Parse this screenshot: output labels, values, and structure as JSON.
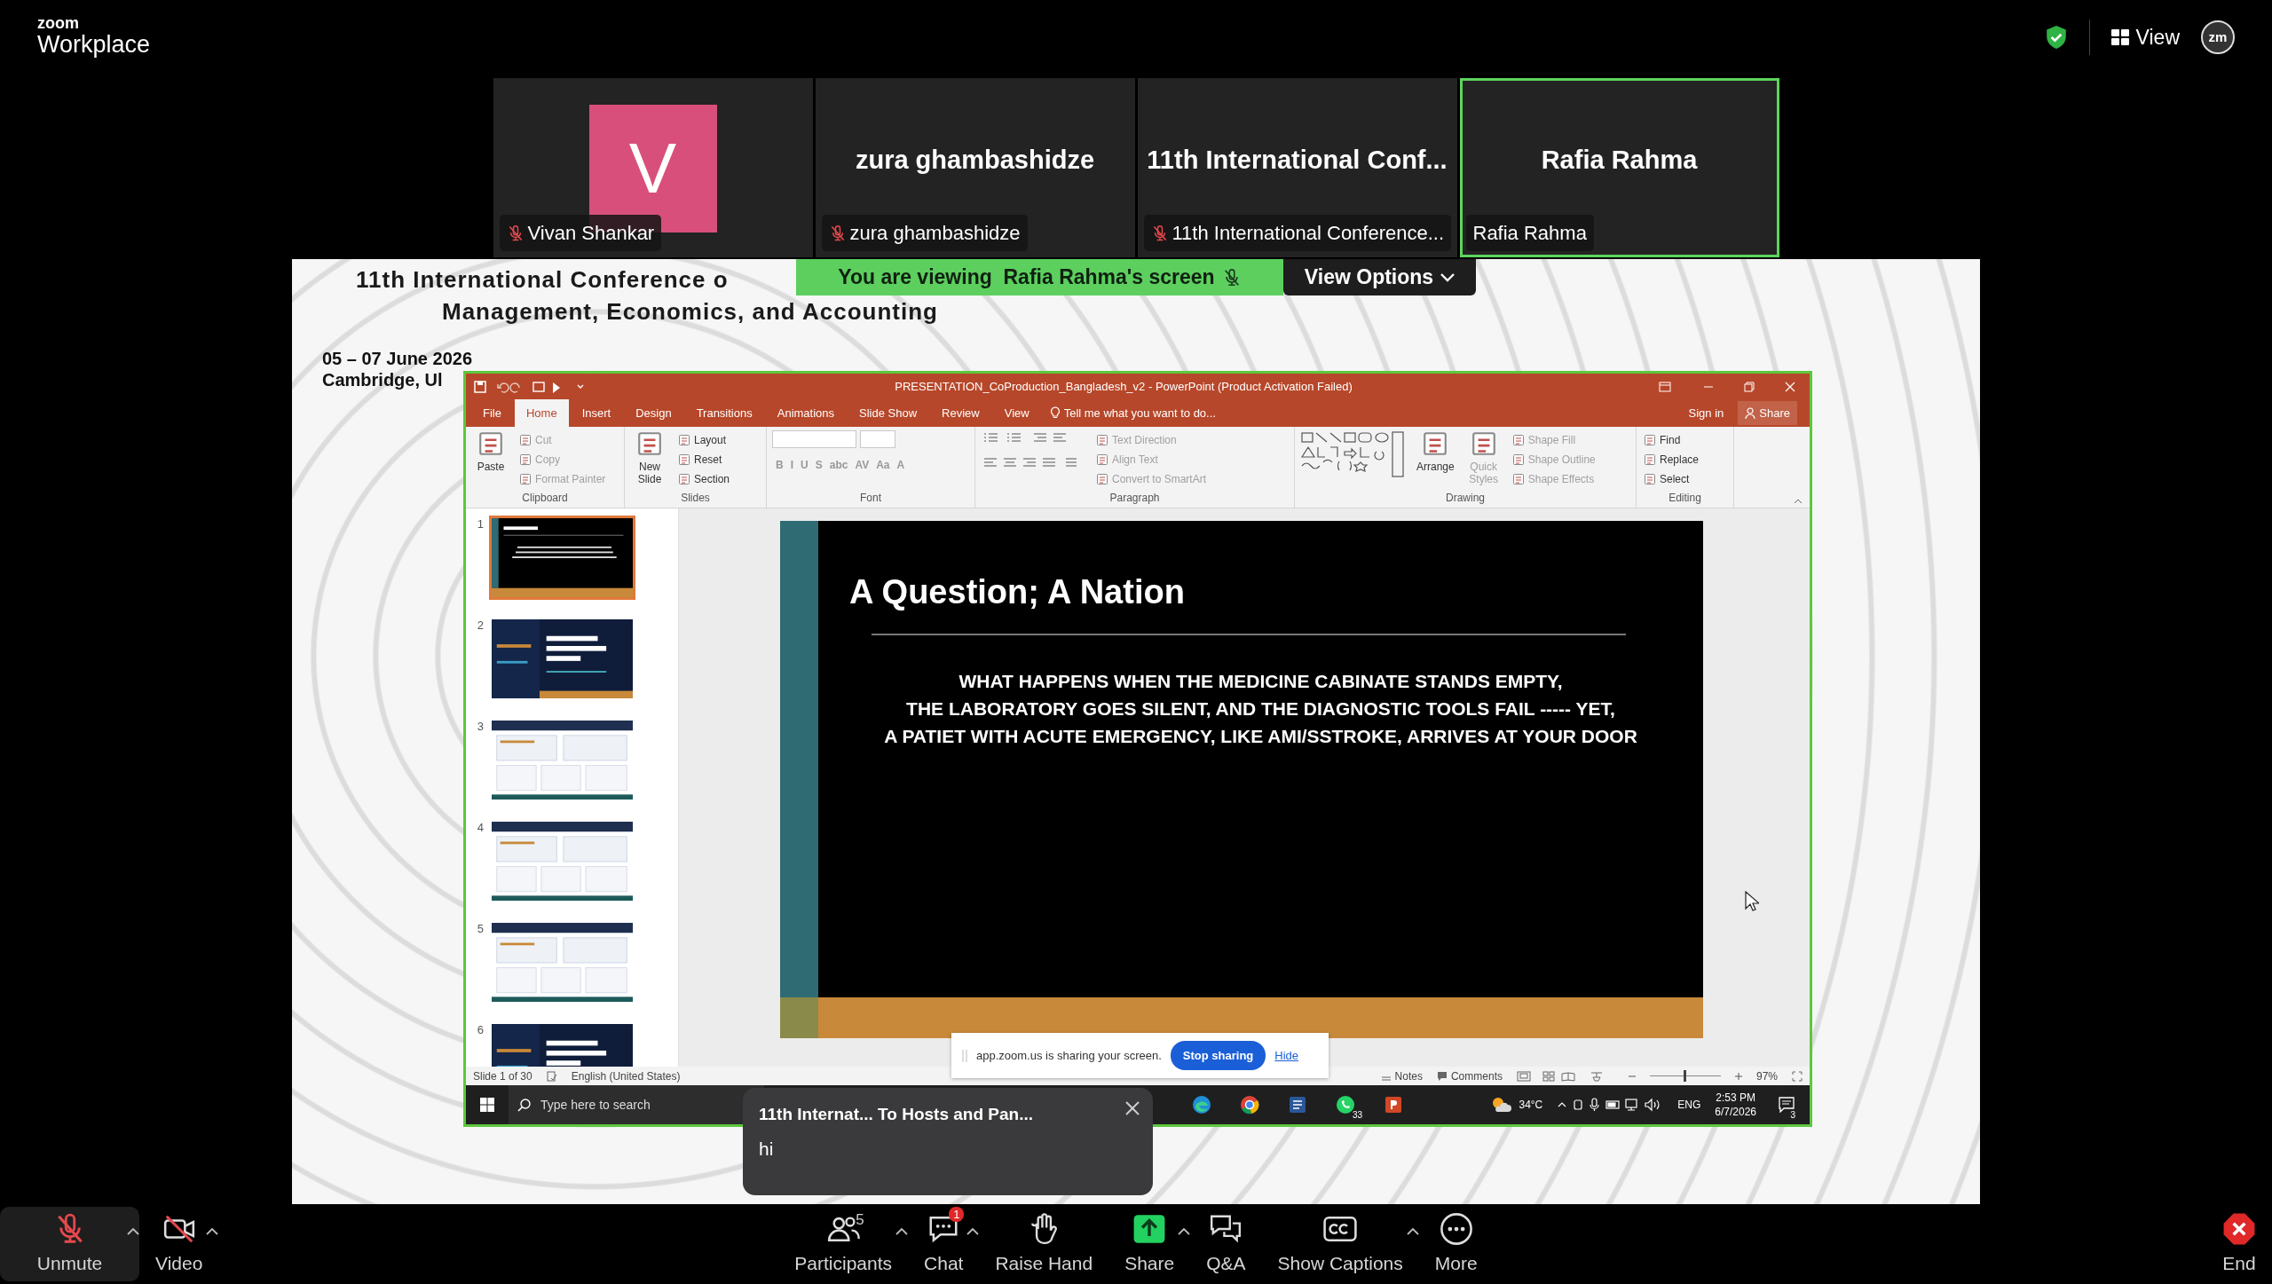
{
  "top_bar": {
    "logo_small": "zoom",
    "logo_large": "Workplace",
    "view_label": "View",
    "avatar_text": "zm"
  },
  "participants": [
    {
      "kind": "avatar",
      "avatar_letter": "V",
      "label": "Vivan Shankar",
      "muted": true,
      "active_speaker": false
    },
    {
      "kind": "name",
      "display_name": "zura ghambashidze",
      "label": "zura ghambashidze",
      "muted": true,
      "active_speaker": false
    },
    {
      "kind": "name",
      "display_name": "11th International Conf...",
      "label": "11th International Conference...",
      "muted": true,
      "active_speaker": false
    },
    {
      "kind": "name",
      "display_name": "Rafia Rahma",
      "label": "Rafia Rahma",
      "muted": false,
      "active_speaker": true
    }
  ],
  "share_banner": {
    "text": "You are viewing  Rafia Rahma's screen",
    "presenter_muted": true,
    "view_options": "View Options"
  },
  "shared_screen": {
    "title_line_1": "11th International Conference o",
    "title_line_2": "Management, Economics, and Accounting",
    "dates": "05 – 07 June 2026",
    "place": "Cambridge, Ul",
    "powerpoint": {
      "window_title": "PRESENTATION_CoProduction_Bangladesh_v2 - PowerPoint (Product Activation Failed)",
      "tabs": [
        {
          "label": "File",
          "selected": false
        },
        {
          "label": "Home",
          "selected": true
        },
        {
          "label": "Insert",
          "selected": false
        },
        {
          "label": "Design",
          "selected": false
        },
        {
          "label": "Transitions",
          "selected": false
        },
        {
          "label": "Animations",
          "selected": false
        },
        {
          "label": "Slide Show",
          "selected": false
        },
        {
          "label": "Review",
          "selected": false
        },
        {
          "label": "View",
          "selected": false
        }
      ],
      "tell_me": "Tell me what you want to do...",
      "sign_in": "Sign in",
      "share": "Share",
      "ribbon": [
        {
          "label": "Clipboard",
          "items": [
            {
              "kind": "large",
              "label": "Paste",
              "disabled": false
            },
            {
              "kind": "small",
              "label": "Cut",
              "disabled": true
            },
            {
              "kind": "small",
              "label": "Copy",
              "disabled": true
            },
            {
              "kind": "small",
              "label": "Format Painter",
              "disabled": true
            }
          ]
        },
        {
          "label": "Slides",
          "items": [
            {
              "kind": "large",
              "label": "New Slide",
              "disabled": false
            },
            {
              "kind": "small",
              "label": "Layout",
              "disabled": false
            },
            {
              "kind": "small",
              "label": "Reset",
              "disabled": false
            },
            {
              "kind": "small",
              "label": "Section",
              "disabled": false
            }
          ]
        },
        {
          "label": "Font",
          "items": [
            {
              "kind": "font_fields"
            },
            {
              "kind": "glyphs",
              "labels": [
                "B",
                "I",
                "U",
                "S",
                "abc",
                "AV",
                "Aa",
                "A"
              ]
            }
          ]
        },
        {
          "label": "Paragraph",
          "items": [
            {
              "kind": "paragraph_icons"
            },
            {
              "kind": "small",
              "label": "Text Direction",
              "disabled": true
            },
            {
              "kind": "small",
              "label": "Align Text",
              "disabled": true
            },
            {
              "kind": "small",
              "label": "Convert to SmartArt",
              "disabled": true
            }
          ]
        },
        {
          "label": "Drawing",
          "items": [
            {
              "kind": "shapes_gallery"
            },
            {
              "kind": "large",
              "label": "Arrange",
              "disabled": false
            },
            {
              "kind": "large",
              "label": "Quick Styles",
              "disabled": true
            },
            {
              "kind": "small",
              "label": "Shape Fill",
              "disabled": true
            },
            {
              "kind": "small",
              "label": "Shape Outline",
              "disabled": true
            },
            {
              "kind": "small",
              "label": "Shape Effects",
              "disabled": true
            }
          ]
        },
        {
          "label": "Editing",
          "items": [
            {
              "kind": "small",
              "label": "Find",
              "disabled": false
            },
            {
              "kind": "small",
              "label": "Replace",
              "disabled": false
            },
            {
              "kind": "small",
              "label": "Select",
              "disabled": false
            }
          ]
        }
      ],
      "thumbnails": [
        {
          "number": "1",
          "kind": "title",
          "selected": true
        },
        {
          "number": "2",
          "kind": "dark",
          "selected": false
        },
        {
          "number": "3",
          "kind": "light",
          "selected": false
        },
        {
          "number": "4",
          "kind": "light",
          "selected": false
        },
        {
          "number": "5",
          "kind": "light",
          "selected": false
        },
        {
          "number": "6",
          "kind": "dark",
          "selected": false
        }
      ],
      "slide": {
        "title": "A Question; A Nation",
        "body": [
          "WHAT HAPPENS WHEN THE MEDICINE CABINATE STANDS EMPTY,",
          "THE LABORATORY GOES SILENT, AND THE DIAGNOSTIC TOOLS FAIL ----- YET,",
          "A PATIET WITH ACUTE EMERGENCY, LIKE AMI/SSTROKE, ARRIVES AT YOUR DOOR"
        ]
      },
      "status_bar": {
        "slide_info": "Slide 1 of 30",
        "language": "English (United States)",
        "notes": "Notes",
        "comments": "Comments",
        "zoom_slider": {
          "level": 0.47
        },
        "zoom_percent": "97%"
      },
      "taskbar": {
        "search_placeholder": "Type here to search",
        "apps": [
          {
            "kind": "edge"
          },
          {
            "kind": "chrome"
          },
          {
            "kind": "word"
          },
          {
            "kind": "whatsapp",
            "badge": "33"
          },
          {
            "kind": "powerpoint"
          }
        ],
        "weather": "34°C",
        "language": "ENG",
        "time": "2:53 PM",
        "date": "6/7/2026",
        "notifications": "3"
      }
    },
    "share_notice": {
      "text": "app.zoom.us is sharing your screen.",
      "stop": "Stop sharing",
      "hide": "Hide"
    }
  },
  "chat_popup": {
    "title": "11th Internat... To Hosts and Pan...",
    "message": "hi"
  },
  "toolbar": {
    "left": [
      {
        "kind": "mic",
        "label": "Unmute",
        "off": true,
        "menu": true
      },
      {
        "kind": "video",
        "label": "Video",
        "off": true,
        "menu": true
      }
    ],
    "center": [
      {
        "kind": "participants",
        "label": "Participants",
        "count": "5",
        "menu": true
      },
      {
        "kind": "chat",
        "label": "Chat",
        "badge": "1",
        "menu": true
      },
      {
        "kind": "hand",
        "label": "Raise Hand",
        "menu": false
      },
      {
        "kind": "share",
        "label": "Share",
        "menu": true
      },
      {
        "kind": "qa",
        "label": "Q&A",
        "menu": false
      },
      {
        "kind": "captions",
        "label": "Show Captions",
        "menu": true
      },
      {
        "kind": "more",
        "label": "More",
        "menu": false
      }
    ],
    "right": [
      {
        "kind": "end",
        "label": "End",
        "menu": false
      }
    ]
  }
}
